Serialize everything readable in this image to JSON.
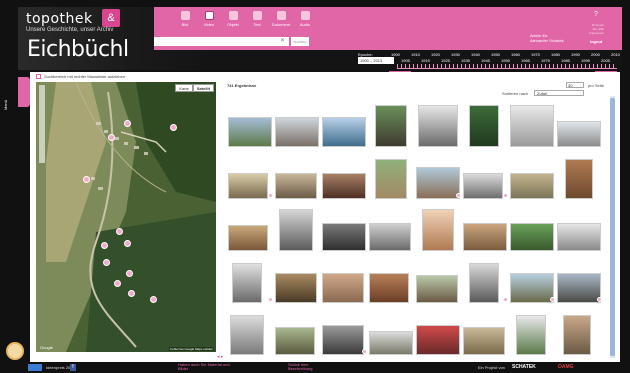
{
  "header": {
    "logo_text": "topothek",
    "tagline": "Unsere Geschichte, unser Archiv",
    "site_title": "Eichbüchl",
    "nav": [
      {
        "label": "Bild",
        "icon": "image-icon"
      },
      {
        "label": "Video",
        "icon": "video-icon"
      },
      {
        "label": "Objekt",
        "icon": "object-icon"
      },
      {
        "label": "Text",
        "icon": "text-icon"
      },
      {
        "label": "Dokument",
        "icon": "document-icon"
      },
      {
        "label": "Audio",
        "icon": "audio-icon"
      }
    ],
    "search_button": "suchen",
    "admin_label": "Admin für:",
    "admin_name": "Alexander Schatek",
    "logout": "logout",
    "top_links": "Ihr Konto\nZur Hilfe\nImpressum"
  },
  "timeline": {
    "label": "Epoche:",
    "select_value": "1900 – 2013",
    "ticks_top": [
      "1900",
      "1910",
      "1920",
      "1930",
      "1940",
      "1950",
      "1960",
      "1970",
      "1980",
      "1990",
      "2000",
      "2010"
    ],
    "ticks_bottom": [
      "1905",
      "1915",
      "1925",
      "1935",
      "1945",
      "1955",
      "1965",
      "1975",
      "1985",
      "1995",
      "2005"
    ],
    "start_label": "vor 1900",
    "end_label": "nach 2013"
  },
  "sidebar_tab": "Menü",
  "map": {
    "checkbox_label": "Suchbereich mit rechter Mausleiste aufziehen",
    "tabs": [
      "Karte",
      "Satellit"
    ],
    "active_tab": "Satellit",
    "google_label": "Google",
    "attribution": "Fehler bei Google Maps melden"
  },
  "results": {
    "count_text": "741 Ergebnisse",
    "sort_label": "Sortieren nach",
    "sort_value": "Zufall",
    "per_page_value": "30",
    "per_page_label": "pro Seite"
  },
  "footer": {
    "ideen_label": "Ideenpreis 2010",
    "link1": "Haben auch Sie Material und\nBilder",
    "link2": "Schick eine\nBeschreibung",
    "project_label": "Ein Projekt von",
    "schatex": "SCHATEK",
    "oamg": "OAMG"
  },
  "colors": {
    "accent": "#e066a8",
    "header_bg": "#141414",
    "map_bg": "#3f5a2a"
  }
}
